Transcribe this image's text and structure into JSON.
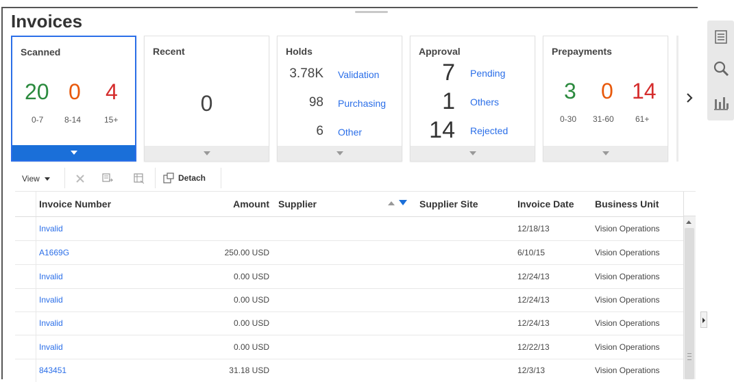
{
  "page": {
    "title": "Invoices"
  },
  "tiles": {
    "scanned": {
      "title": "Scanned",
      "values": [
        {
          "value": "20",
          "range": "0-7",
          "color": "#2b8a3e"
        },
        {
          "value": "0",
          "range": "8-14",
          "color": "#e8590c"
        },
        {
          "value": "4",
          "range": "15+",
          "color": "#d52d2d"
        }
      ]
    },
    "recent": {
      "title": "Recent",
      "value": "0"
    },
    "holds": {
      "title": "Holds",
      "rows": [
        {
          "count": "3.78K",
          "label": "Validation"
        },
        {
          "count": "98",
          "label": "Purchasing"
        },
        {
          "count": "6",
          "label": "Other"
        }
      ]
    },
    "approval": {
      "title": "Approval",
      "rows": [
        {
          "count": "7",
          "label": "Pending"
        },
        {
          "count": "1",
          "label": "Others"
        },
        {
          "count": "14",
          "label": "Rejected"
        }
      ]
    },
    "prepayments": {
      "title": "Prepayments",
      "values": [
        {
          "value": "3",
          "range": "0-30",
          "color": "#2b8a3e"
        },
        {
          "value": "0",
          "range": "31-60",
          "color": "#e8590c"
        },
        {
          "value": "14",
          "range": "61+",
          "color": "#d52d2d"
        }
      ]
    },
    "next_icon": "chevron-right-icon"
  },
  "side_panel": {
    "icons": [
      "document-list-icon",
      "search-icon",
      "bar-chart-icon"
    ]
  },
  "toolbar": {
    "view_label": "View",
    "detach_label": "Detach",
    "icons": [
      "delete-x-icon",
      "export-icon",
      "freeze-icon",
      "detach-icon"
    ]
  },
  "table": {
    "headers": {
      "invoice_number": "Invoice Number",
      "amount": "Amount",
      "supplier": "Supplier",
      "supplier_site": "Supplier Site",
      "invoice_date": "Invoice Date",
      "business_unit": "Business Unit"
    },
    "rows": [
      {
        "invoice_number": "Invalid",
        "amount": "",
        "supplier": "",
        "supplier_site": "",
        "invoice_date": "12/18/13",
        "business_unit": "Vision Operations"
      },
      {
        "invoice_number": "A1669G",
        "amount": "250.00 USD",
        "supplier": "",
        "supplier_site": "",
        "invoice_date": "6/10/15",
        "business_unit": "Vision Operations"
      },
      {
        "invoice_number": "Invalid",
        "amount": "0.00 USD",
        "supplier": "",
        "supplier_site": "",
        "invoice_date": "12/24/13",
        "business_unit": "Vision Operations"
      },
      {
        "invoice_number": "Invalid",
        "amount": "0.00 USD",
        "supplier": "",
        "supplier_site": "",
        "invoice_date": "12/24/13",
        "business_unit": "Vision Operations"
      },
      {
        "invoice_number": "Invalid",
        "amount": "0.00 USD",
        "supplier": "",
        "supplier_site": "",
        "invoice_date": "12/24/13",
        "business_unit": "Vision Operations"
      },
      {
        "invoice_number": "Invalid",
        "amount": "0.00 USD",
        "supplier": "",
        "supplier_site": "",
        "invoice_date": "12/22/13",
        "business_unit": "Vision Operations"
      },
      {
        "invoice_number": "843451",
        "amount": "31.18 USD",
        "supplier": "",
        "supplier_site": "",
        "invoice_date": "12/3/13",
        "business_unit": "Vision Operations"
      }
    ]
  },
  "colors": {
    "accent": "#1a6fd9",
    "link": "#2a6ee8"
  }
}
